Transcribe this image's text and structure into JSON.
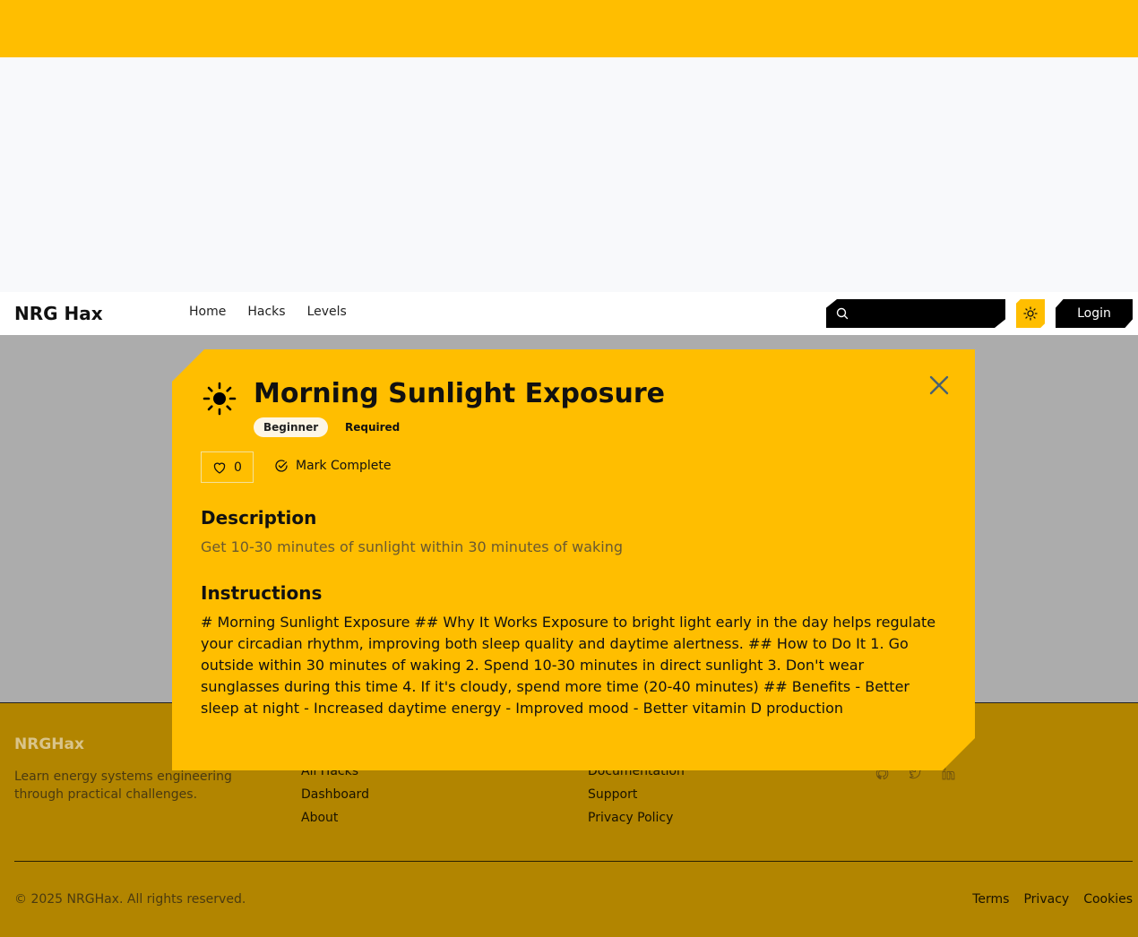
{
  "navbar": {
    "brand": "NRG Hax",
    "links": [
      "Home",
      "Hacks",
      "Levels"
    ],
    "search_placeholder": "",
    "login_label": "Login"
  },
  "modal": {
    "icon": "sun-icon",
    "title": "Morning Sunlight Exposure",
    "badges": [
      "Beginner",
      "Required"
    ],
    "like_count": "0",
    "mark_complete_label": "Mark Complete",
    "description_heading": "Description",
    "description": "Get 10-30 minutes of sunlight within 30 minutes of waking",
    "instructions_heading": "Instructions",
    "instructions": "# Morning Sunlight Exposure ## Why It Works Exposure to bright light early in the day helps regulate your circadian rhythm, improving both sleep quality and daytime alertness. ## How to Do It 1. Go outside within 30 minutes of waking 2. Spend 10-30 minutes in direct sunlight 3. Don't wear sunglasses during this time 4. If it's cloudy, spend more time (20-40 minutes) ## Benefits - Better sleep at night - Increased daytime energy - Improved mood - Better vitamin D production"
  },
  "footer": {
    "brand": "NRGHax",
    "tagline": "Learn energy systems engineering through practical challenges.",
    "col1": [
      "All Hacks",
      "Dashboard",
      "About"
    ],
    "col2": [
      "Documentation",
      "Support",
      "Privacy Policy"
    ],
    "social_icons": [
      "github-icon",
      "twitter-icon",
      "linkedin-icon"
    ],
    "copyright": "© 2025 NRGHax. All rights reserved.",
    "legal": [
      "Terms",
      "Privacy",
      "Cookies"
    ]
  },
  "colors": {
    "accent": "#ffbe00",
    "footer_bg": "#b28500",
    "overlay": "#acacac"
  }
}
